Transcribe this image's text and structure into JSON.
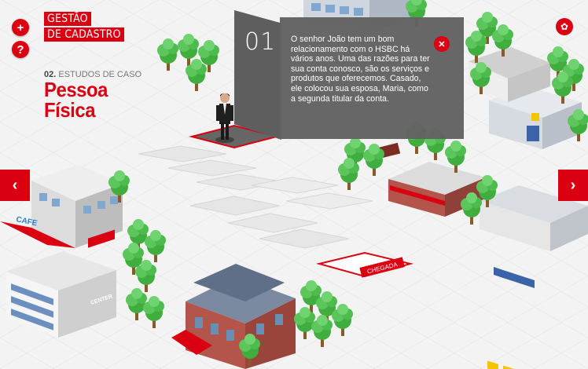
{
  "header": {
    "add_icon": "+",
    "help_icon": "?",
    "app_title_line1": "GESTÃO",
    "app_title_line2": "DE CADASTRO",
    "section_number": "02.",
    "section_name": "ESTUDOS DE CASO",
    "page_title_line1": "Pessoa",
    "page_title_line2": "Física",
    "favorite_icon": "✿"
  },
  "dialog": {
    "step_number": "01",
    "text": "O senhor João tem um bom relacionamento com o HSBC há vários anos. Uma das razões para ter sua conta conosco, são os serviços e produtos que oferecemos. Casado, ele colocou sua esposa, Maria, como a segunda titular da conta.",
    "close_icon": "✕"
  },
  "nav": {
    "prev_icon": "‹",
    "next_icon": "›"
  },
  "scene": {
    "cafe_sign": "CAFE",
    "center_sign": "CENTER",
    "finish_label": "CHEGADA",
    "shop_sign": "CAFE",
    "brand_red": "#db0011"
  }
}
